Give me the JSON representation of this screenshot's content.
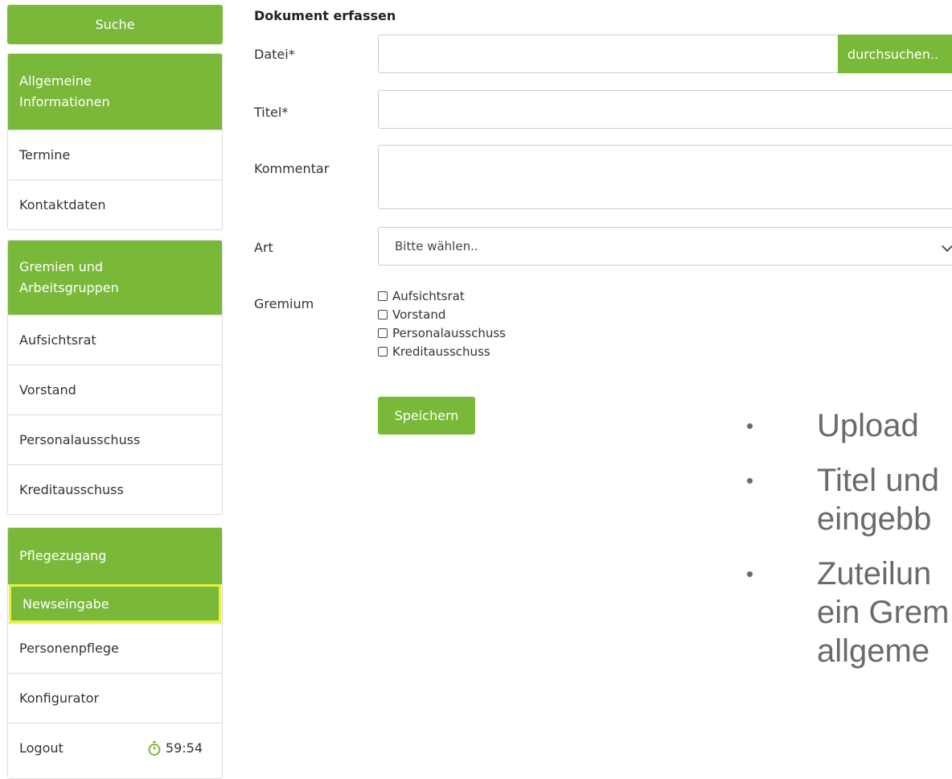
{
  "sidebar": {
    "search_label": "Suche",
    "group1": {
      "title_line1": "Allgemeine",
      "title_line2": "Informationen",
      "items": [
        "Termine",
        "Kontaktdaten"
      ]
    },
    "group2": {
      "title_line1": "Gremien und",
      "title_line2": "Arbeitsgruppen",
      "items": [
        "Aufsichtsrat",
        "Vorstand",
        "Personalausschuss",
        "Kreditausschuss"
      ]
    },
    "group3": {
      "title": "Pflegezugang",
      "items": [
        "Newseingabe",
        "Personenpflege",
        "Konfigurator"
      ],
      "logout": "Logout",
      "timer": "59:54"
    },
    "colors": {
      "accent": "#7ab83a",
      "highlight": "#e8f33a"
    }
  },
  "form": {
    "title": "Dokument erfassen",
    "file_label": "Datei*",
    "browse_label": "durchsuchen..",
    "title_label": "Titel*",
    "comment_label": "Kommentar",
    "type_label": "Art",
    "type_selected": "Bitte wählen..",
    "committee_label": "Gremium",
    "committees": [
      "Aufsichtsrat",
      "Vorstand",
      "Personalausschuss",
      "Kreditausschuss"
    ],
    "save_label": "Speichern"
  },
  "bullets": [
    {
      "line1": "Upload"
    },
    {
      "line1": "Titel und",
      "line2": "eingebb"
    },
    {
      "line1": "Zuteilun",
      "line2": "ein Grem",
      "line3": "allgeme"
    }
  ]
}
